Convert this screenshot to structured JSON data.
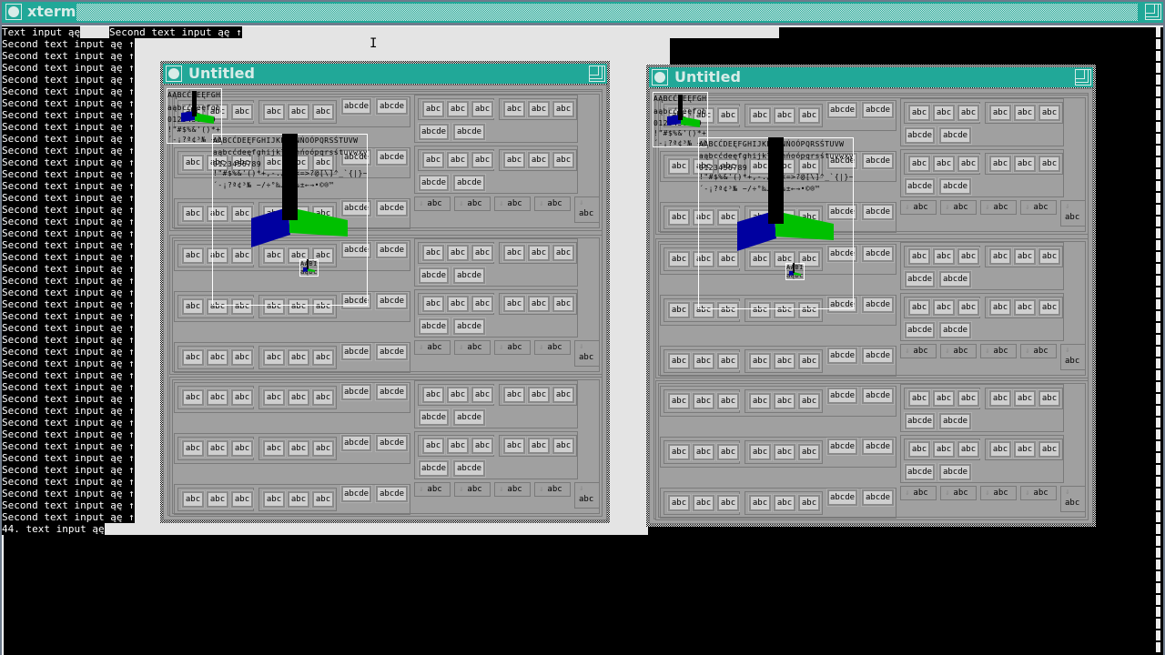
{
  "xterm": {
    "title": "xterm",
    "first_line": "Text input ąę",
    "first_line_second": "Second text input ąę ↑",
    "repeat_line": "Second text input ąę ↑",
    "repeat_count": 41,
    "last_line": "44. text input ąę"
  },
  "windows": [
    {
      "title": "Untitled"
    },
    {
      "title": "Untitled"
    }
  ],
  "buttons": {
    "short": "abc",
    "long": "abcde",
    "arrow_icon": "arrow-down-icon"
  },
  "font_sample": {
    "upper": "AĄBCĆDEĘFGHIJKLŁMNŃOÓPQRSŚTUVW",
    "lower": "aąbcćdeęfghijklłmnńoópqrsśtuvwxy",
    "digits": "0123456789",
    "punct": "!\"#$%&'()*+,-./:;<=>?@[\\]^_`{|}~",
    "symbols": "´-¡?ª¢³№ −/÷°‰…–—‰±←→•©®™",
    "tiny_upper": "AĄBI",
    "tiny_lower": "aąbc"
  },
  "colors": {
    "titlebar": "#21a898",
    "blue": "#0000a0",
    "green": "#00c000"
  }
}
